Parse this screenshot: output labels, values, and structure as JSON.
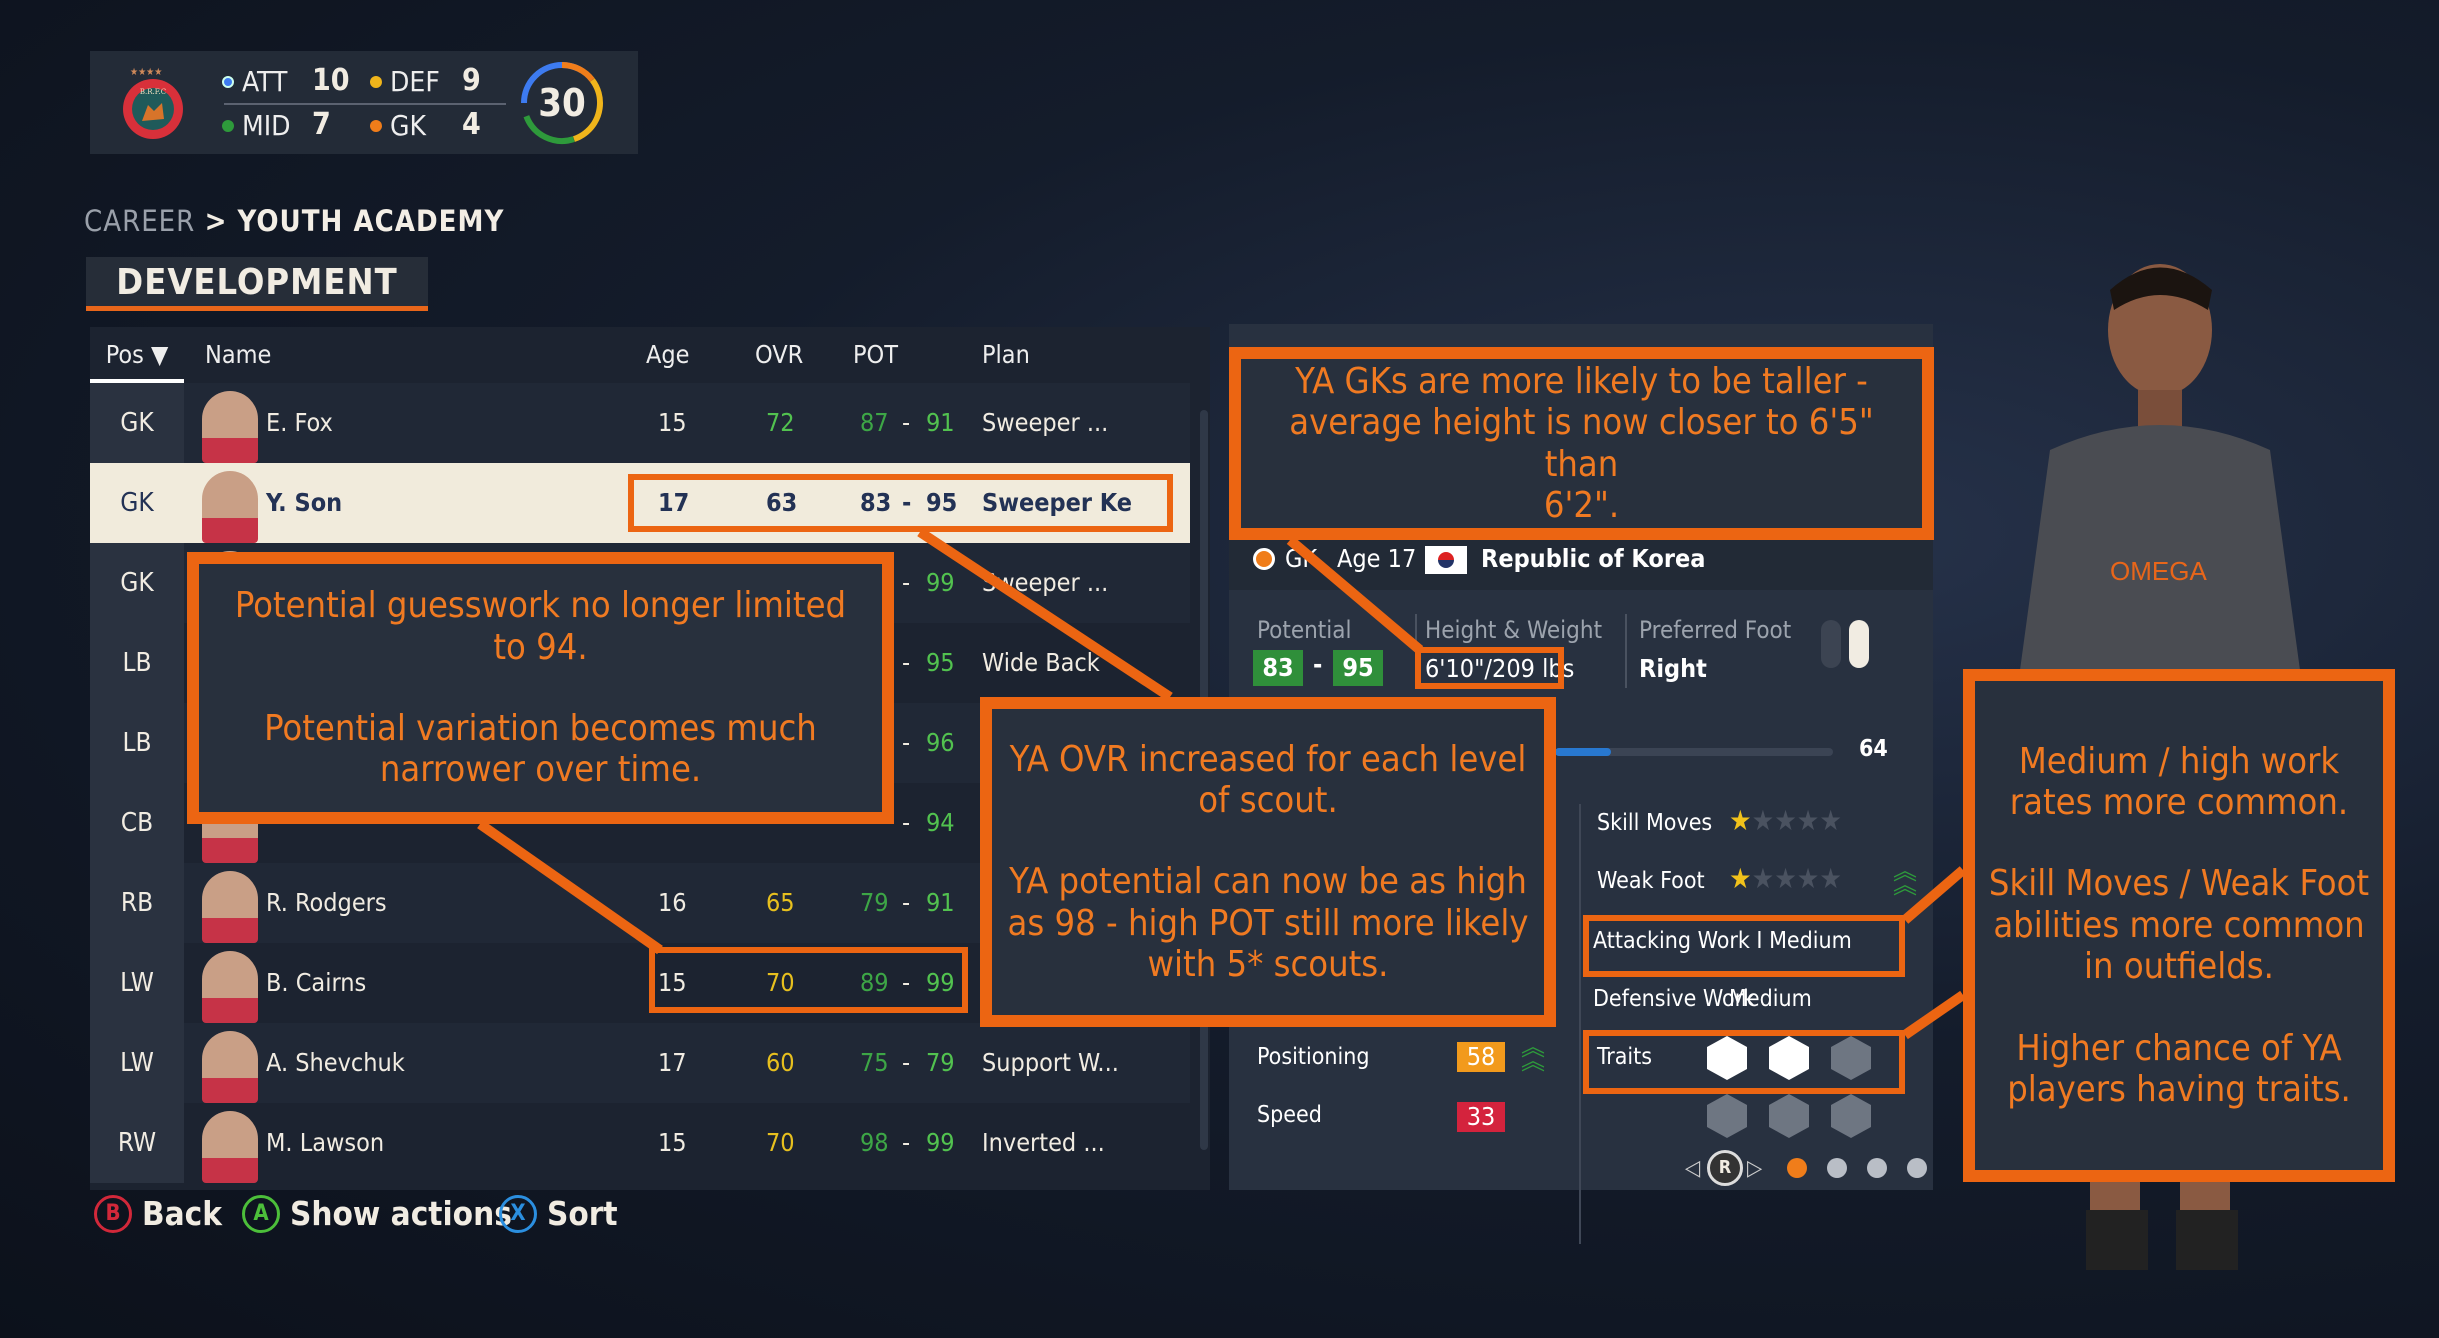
{
  "squad_summary": {
    "att_label": "ATT",
    "att": "10",
    "def_label": "DEF",
    "def": "9",
    "mid_label": "MID",
    "mid": "7",
    "gk_label": "GK",
    "gk": "4",
    "total": "30",
    "colors": {
      "att": "#3d7bf0",
      "def": "#f0b51b",
      "mid": "#2e9a3b",
      "gk": "#f07d1a"
    },
    "crest_text": "B.R.F.C"
  },
  "breadcrumb": {
    "parent": "CAREER",
    "current": "YOUTH ACADEMY"
  },
  "tab": "DEVELOPMENT",
  "table": {
    "headers": {
      "pos": "Pos",
      "name": "Name",
      "age": "Age",
      "ovr": "OVR",
      "pot": "POT",
      "plan": "Plan"
    },
    "rows": [
      {
        "pos": "GK",
        "name": "E. Fox",
        "age": "15",
        "ovr": "72",
        "ovr_color": "g2",
        "pot_min": "87",
        "sep": "-",
        "pot_max": "91",
        "plan": "Sweeper ..."
      },
      {
        "pos": "GK",
        "name": "Y. Son",
        "age": "17",
        "ovr": "63",
        "ovr_color": "",
        "pot_min": "83",
        "sep": "-",
        "pot_max": "95",
        "plan": "Sweeper Ke",
        "selected": true
      },
      {
        "pos": "GK",
        "name": "",
        "age": "",
        "ovr": "",
        "pot_min": "",
        "sep": "-",
        "pot_max": "99",
        "plan": "Sweeper ..."
      },
      {
        "pos": "LB",
        "name": "",
        "age": "",
        "ovr": "",
        "pot_min": "",
        "sep": "-",
        "pot_max": "95",
        "plan": "Wide Back"
      },
      {
        "pos": "LB",
        "name": "",
        "age": "",
        "ovr": "",
        "pot_min": "",
        "sep": "-",
        "pot_max": "96",
        "plan": ""
      },
      {
        "pos": "CB",
        "name": "",
        "age": "",
        "ovr": "",
        "pot_min": "",
        "sep": "-",
        "pot_max": "94",
        "plan": ""
      },
      {
        "pos": "RB",
        "name": "R. Rodgers",
        "age": "16",
        "ovr": "65",
        "ovr_color": "y",
        "pot_min": "79",
        "sep": "-",
        "pot_max": "91",
        "plan": ""
      },
      {
        "pos": "LW",
        "name": "B. Cairns",
        "age": "15",
        "ovr": "70",
        "ovr_color": "y",
        "pot_min": "89",
        "sep": "-",
        "pot_max": "99",
        "plan": ""
      },
      {
        "pos": "LW",
        "name": "A. Shevchuk",
        "age": "17",
        "ovr": "60",
        "ovr_color": "y",
        "pot_min": "75",
        "sep": "-",
        "pot_max": "79",
        "plan": "Support W..."
      },
      {
        "pos": "RW",
        "name": "M. Lawson",
        "age": "15",
        "ovr": "70",
        "ovr_color": "y",
        "pot_min": "98",
        "sep": "-",
        "pot_max": "99",
        "plan": "Inverted ..."
      }
    ]
  },
  "player": {
    "pos": "GK",
    "age": "Age 17",
    "nation": "Republic of Korea",
    "potential_label": "Potential",
    "pot_min": "83",
    "pot_sep": "-",
    "pot_max": "95",
    "hw_label": "Height & Weight",
    "hw": "6'10\"/209 lbs",
    "foot_label": "Preferred Foot",
    "foot": "Right",
    "progress_value": "64",
    "progress_fraction": 0.2,
    "skill_label": "Skill Moves",
    "skill_stars": 1,
    "weak_label": "Weak Foot",
    "weak_stars": 1,
    "att_work": "Attacking Work I Medium",
    "def_work_label": "Defensive Work",
    "def_work": "Medium",
    "traits_label": "Traits",
    "positioning_label": "Positioning",
    "positioning": "58",
    "positioning_color": "#f29a1c",
    "speed_label": "Speed",
    "speed": "33",
    "speed_color": "#d4233d",
    "page_indicator": "R",
    "pages": 4,
    "active_page": 1
  },
  "callouts": {
    "gk_height": [
      "YA GKs are more likely to be taller -",
      "average height is now closer to 6'5\" than",
      "6'2\"."
    ],
    "potential": [
      "Potential guesswork no longer limited",
      "to 94.",
      "Potential variation becomes much",
      "narrower over time."
    ],
    "ovr": [
      "YA OVR increased for each level",
      "of scout.",
      "YA potential can now be as high",
      "as 98 - high POT still more likely",
      "with 5* scouts."
    ],
    "work": [
      "Medium / high work",
      "rates more common.",
      "Skill Moves / Weak Foot",
      "abilities more common",
      "in outfields.",
      "Higher chance of YA",
      "players having traits."
    ]
  },
  "footer": {
    "back_key": "B",
    "back": "Back",
    "actions_key": "A",
    "actions": "Show actions",
    "sort_key": "X",
    "sort": "Sort"
  },
  "accent": "#ec6512"
}
